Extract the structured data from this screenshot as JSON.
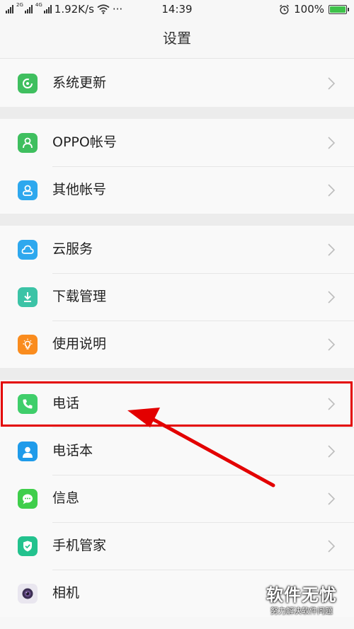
{
  "status_bar": {
    "net_tag_1": "2G",
    "net_tag_2": "4G",
    "speed": "1.92K/s",
    "more": "···",
    "time": "14:39",
    "battery": "100%"
  },
  "header": {
    "title": "设置"
  },
  "groups": [
    {
      "items": [
        {
          "label": "系统更新",
          "icon": "refresh-icon",
          "color": "#3fbf5f"
        }
      ]
    },
    {
      "items": [
        {
          "label": "OPPO帐号",
          "icon": "user-icon",
          "color": "#3fbf5f"
        },
        {
          "label": "其他帐号",
          "icon": "user-outline-icon",
          "color": "#2ea8ee"
        }
      ]
    },
    {
      "items": [
        {
          "label": "云服务",
          "icon": "cloud-icon",
          "color": "#2ea8ee"
        },
        {
          "label": "下载管理",
          "icon": "download-icon",
          "color": "#3cc3a6"
        },
        {
          "label": "使用说明",
          "icon": "lightbulb-icon",
          "color": "#fa8c1e"
        }
      ]
    },
    {
      "items": [
        {
          "label": "电话",
          "icon": "phone-icon",
          "color": "#3fce6a"
        },
        {
          "label": "电话本",
          "icon": "contacts-icon",
          "color": "#1f9bea"
        },
        {
          "label": "信息",
          "icon": "message-icon",
          "color": "#3fce4b"
        },
        {
          "label": "手机管家",
          "icon": "shield-icon",
          "color": "#23c28e"
        },
        {
          "label": "相机",
          "icon": "camera-icon",
          "color": "#6a4f8c"
        }
      ]
    }
  ],
  "watermark": {
    "title": "软件无忧",
    "subtitle": "努力解决软件问题"
  },
  "colors": {
    "highlight": "#e30000",
    "arrow": "#e30000",
    "battery": "#3ec24a"
  }
}
